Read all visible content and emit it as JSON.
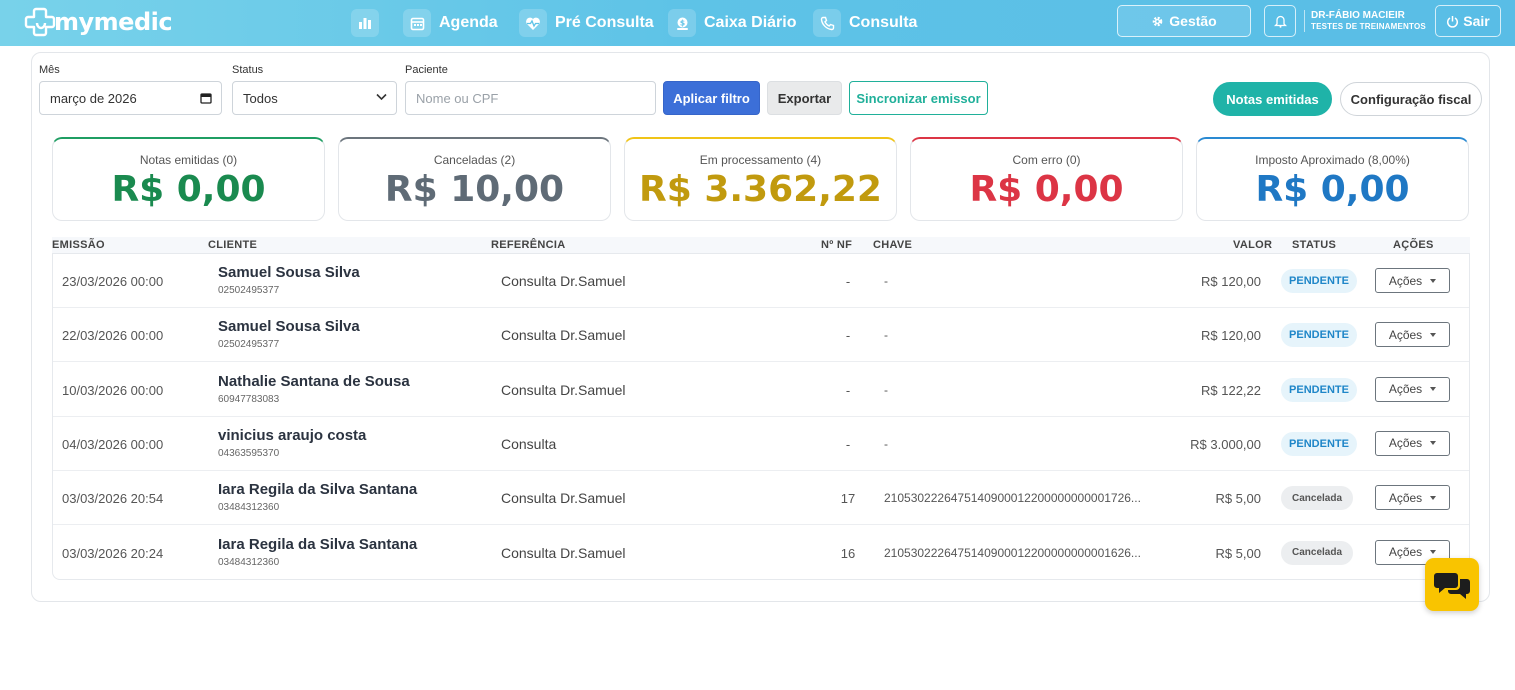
{
  "brand": {
    "name": "mymedic"
  },
  "nav": [
    {
      "label": "",
      "icon": "bar-chart-icon"
    },
    {
      "label": "Agenda",
      "icon": "calendar-icon"
    },
    {
      "label": "Pré Consulta",
      "icon": "heart-pulse-icon"
    },
    {
      "label": "Caixa Diário",
      "icon": "money-icon"
    },
    {
      "label": "Consulta",
      "icon": "phone-icon"
    }
  ],
  "header": {
    "gestao_label": "Gestão",
    "user_name": "DR-FÁBIO MACIEIR",
    "user_sub": "TESTES DE TREINAMENTOS",
    "sair_label": "Sair"
  },
  "filters": {
    "mes_label": "Mês",
    "mes_value": "março de 2026",
    "status_label": "Status",
    "status_value": "Todos",
    "paciente_label": "Paciente",
    "paciente_placeholder": "Nome ou CPF",
    "aplicar_label": "Aplicar filtro",
    "exportar_label": "Exportar",
    "sincronizar_label": "Sincronizar emissor",
    "notas_label": "Notas emitidas",
    "config_label": "Configuração fiscal"
  },
  "stats": [
    {
      "label": "Notas emitidas (0)",
      "value": "R$ 0,00",
      "color": "#1a8a4f",
      "border": "#1f9e63"
    },
    {
      "label": "Canceladas (2)",
      "value": "R$ 10,00",
      "color": "#5f6b76",
      "border": "#6c757d"
    },
    {
      "label": "Em processamento (4)",
      "value": "R$ 3.362,22",
      "color": "#c19a0e",
      "border": "#f0c418"
    },
    {
      "label": "Com erro (0)",
      "value": "R$ 0,00",
      "color": "#dc3545",
      "border": "#dc3545"
    },
    {
      "label": "Imposto Aproximado (8,00%)",
      "value": "R$ 0,00",
      "color": "#1f78c4",
      "border": "#2a8ad2"
    }
  ],
  "table": {
    "headers": {
      "emissao": "EMISSÃO",
      "cliente": "CLIENTE",
      "referencia": "REFERÊNCIA",
      "nf": "Nº NF",
      "chave": "CHAVE",
      "valor": "VALOR",
      "status": "STATUS",
      "acoes": "AÇÕES"
    },
    "rows": [
      {
        "date": "23/03/2026 00:00",
        "name": "Samuel Sousa Silva",
        "cpf": "02502495377",
        "ref": "Consulta Dr.Samuel",
        "nf": "-",
        "key": "-",
        "value": "R$ 120,00",
        "status": "PENDENTE",
        "status_type": "pend",
        "acoes": "Ações"
      },
      {
        "date": "22/03/2026 00:00",
        "name": "Samuel Sousa Silva",
        "cpf": "02502495377",
        "ref": "Consulta Dr.Samuel",
        "nf": "-",
        "key": "-",
        "value": "R$ 120,00",
        "status": "PENDENTE",
        "status_type": "pend",
        "acoes": "Ações"
      },
      {
        "date": "10/03/2026 00:00",
        "name": "Nathalie Santana de Sousa",
        "cpf": "60947783083",
        "ref": "Consulta Dr.Samuel",
        "nf": "-",
        "key": "-",
        "value": "R$ 122,22",
        "status": "PENDENTE",
        "status_type": "pend",
        "acoes": "Ações"
      },
      {
        "date": "04/03/2026 00:00",
        "name": "vinicius araujo costa",
        "cpf": "04363595370",
        "ref": "Consulta",
        "nf": "-",
        "key": "-",
        "value": "R$ 3.000,00",
        "status": "PENDENTE",
        "status_type": "pend",
        "acoes": "Ações"
      },
      {
        "date": "03/03/2026 20:54",
        "name": "Iara Regila da Silva Santana",
        "cpf": "03484312360",
        "ref": "Consulta Dr.Samuel",
        "nf": "17",
        "key": "2105302226475140900012200000000001726...",
        "value": "R$ 5,00",
        "status": "Cancelada",
        "status_type": "canc",
        "acoes": "Ações"
      },
      {
        "date": "03/03/2026 20:24",
        "name": "Iara Regila da Silva Santana",
        "cpf": "03484312360",
        "ref": "Consulta Dr.Samuel",
        "nf": "16",
        "key": "2105302226475140900012200000000001626...",
        "value": "R$ 5,00",
        "status": "Cancelada",
        "status_type": "canc",
        "acoes": "Ações"
      }
    ]
  },
  "chat": {
    "icon": "chat-bubbles-icon"
  }
}
